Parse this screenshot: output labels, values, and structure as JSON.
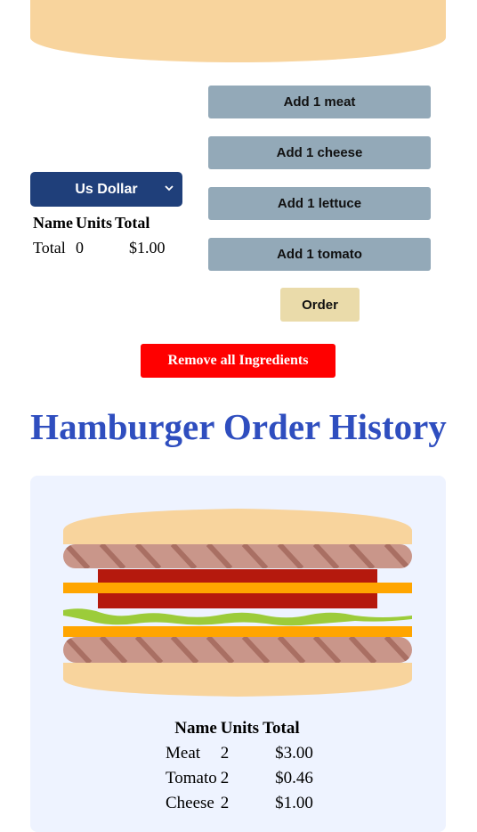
{
  "builder": {
    "buttons": {
      "add_meat": "Add 1 meat",
      "add_cheese": "Add 1 cheese",
      "add_lettuce": "Add 1 lettuce",
      "add_tomato": "Add 1 tomato",
      "order": "Order",
      "remove_all": "Remove all Ingredients"
    },
    "currency": {
      "selected": "Us Dollar"
    },
    "summary": {
      "headers": [
        "Name",
        "Units",
        "Total"
      ],
      "rows": [
        {
          "name": "Total",
          "units": "0",
          "total": "$1.00"
        }
      ]
    }
  },
  "history": {
    "title": "Hamburger Order History",
    "table": {
      "headers": [
        "Name",
        "Units",
        "Total"
      ],
      "rows": [
        {
          "name": "Meat",
          "units": "2",
          "total": "$3.00"
        },
        {
          "name": "Tomato",
          "units": "2",
          "total": "$0.46"
        },
        {
          "name": "Cheese",
          "units": "2",
          "total": "$1.00"
        }
      ]
    }
  },
  "colors": {
    "bun": "#f8d49d",
    "meat": "#c9968a",
    "meat_stripe": "#a96f63",
    "cheese": "#ffa500",
    "tomato": "#b5190d",
    "lettuce": "#9ccc3a",
    "button_gray": "#93a9b8",
    "order_button": "#eadbaa",
    "remove_button": "#ff0000",
    "currency_bg": "#1f3f7a",
    "title_blue": "#2f4ebf"
  }
}
